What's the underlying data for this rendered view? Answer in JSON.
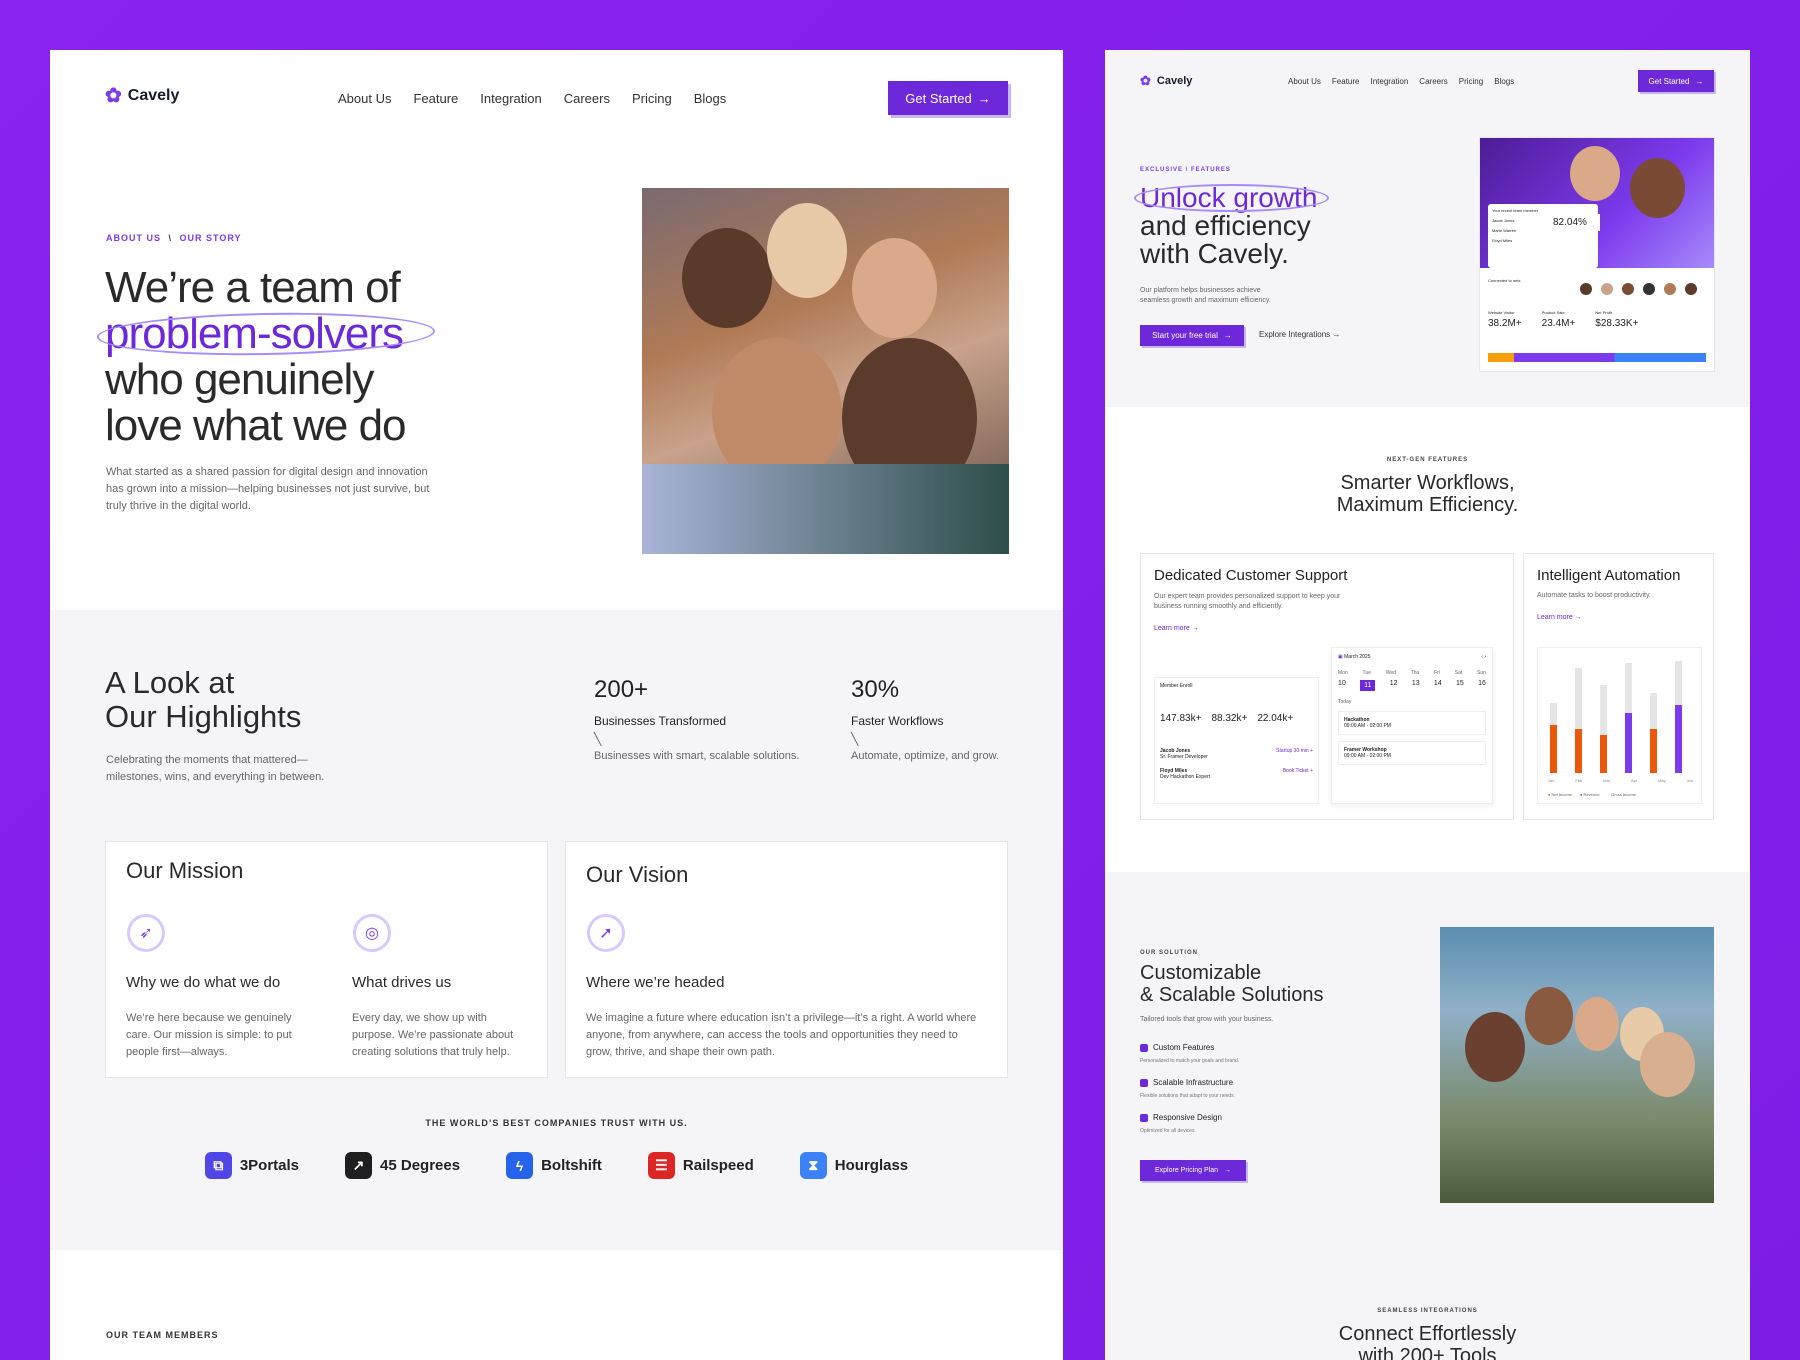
{
  "left": {
    "brand": "Cavely",
    "nav": [
      "About Us",
      "Feature",
      "Integration",
      "Careers",
      "Pricing",
      "Blogs"
    ],
    "cta": "Get Started",
    "cta_arrow": "→",
    "breadcrumb": {
      "a": "ABOUT US",
      "sep": "\\",
      "b": "OUR STORY"
    },
    "hero": {
      "line1": "We’re a team of",
      "highlight": "problem-solvers",
      "line3": "who genuinely",
      "line4": "love what we do",
      "desc": "What started as a shared passion for digital design and innovation has grown into a mission—helping businesses not just survive, but truly thrive in the digital world."
    },
    "highlights": {
      "title1": "A Look at",
      "title2": "Our Highlights",
      "desc": "Celebrating the moments that mattered—milestones, wins, and everything in between.",
      "stats": [
        {
          "value": "200+",
          "label": "Businesses Transformed",
          "note": "Businesses with smart, scalable solutions."
        },
        {
          "value": "30%",
          "label": "Faster Workflows",
          "note": "Automate, optimize, and grow."
        }
      ]
    },
    "mission": {
      "title": "Our Mission",
      "items": [
        {
          "title": "Why we do what we do",
          "desc": "We’re here because we genuinely care. Our mission is simple: to put people first—always."
        },
        {
          "title": "What drives us",
          "desc": "Every day, we show up with purpose. We’re passionate about creating solutions that truly help."
        }
      ]
    },
    "vision": {
      "title": "Our Vision",
      "item_title": "Where we’re headed",
      "desc": "We imagine a future where education isn’t a privilege—it’s a right. A world where anyone, from anywhere, can access the tools and opportunities they need to grow, thrive, and shape their own path."
    },
    "trust": "THE WORLD’S BEST COMPANIES TRUST WITH US.",
    "companies": [
      {
        "name": "3Portals",
        "color": "#4f46e5"
      },
      {
        "name": "45 Degrees",
        "color": "#1f1f1f"
      },
      {
        "name": "Boltshift",
        "color": "#2563eb"
      },
      {
        "name": "Railspeed",
        "color": "#dc2626"
      },
      {
        "name": "Hourglass",
        "color": "#3b82f6"
      }
    ],
    "team_eyebrow": "OUR TEAM MEMBERS"
  },
  "right": {
    "brand": "Cavely",
    "nav": [
      "About Us",
      "Feature",
      "Integration",
      "Careers",
      "Pricing",
      "Blogs"
    ],
    "cta": "Get Started",
    "cta_arrow": "→",
    "hero": {
      "eyebrow": "EXCLUSIVE \\ FEATURES",
      "highlight": "Unlock growth",
      "line2": "and efficiency",
      "line3": "with Cavely.",
      "desc": "Our platform helps businesses achieve seamless growth and maximum efficiency.",
      "primary": "Start your free trial",
      "secondary": "Explore Integrations",
      "arrow": "→"
    },
    "dash": {
      "team_title": "Your recent team member",
      "members": [
        "Jacob Jones",
        "Marie Warren",
        "Floyd Miles"
      ],
      "pct": "82.04%",
      "conn": "Connected to nets",
      "stats": [
        {
          "label": "Website Visitor",
          "value": "38.2M+"
        },
        {
          "label": "Product Sale",
          "value": "23.4M+"
        },
        {
          "label": "Net Profit",
          "value": "$28.33K+"
        }
      ]
    },
    "features": {
      "eyebrow": "NEXT-GEN FEATURES",
      "title1": "Smarter Workflows,",
      "title2": "Maximum Efficiency.",
      "support": {
        "title": "Dedicated Customer Support",
        "desc": "Our expert team provides personalized support to keep your business running smoothly and efficiently.",
        "link": "Learn more",
        "member_label": "Member Enroll",
        "nums": [
          "147.83k+",
          "88.32k+",
          "22.04k+"
        ],
        "people": [
          {
            "name": "Jacob Jones",
            "role": "Sr. Framer Developer",
            "action": "Startup 30 min +"
          },
          {
            "name": "Floyd Miles",
            "role": "Dev Hackathon Expert",
            "action": "Book Ticket +"
          }
        ],
        "cal_title": "March 2025",
        "days": [
          "Mon",
          "Tue",
          "Wed",
          "Thu",
          "Fri",
          "Sat",
          "Sun"
        ],
        "dates": [
          "10",
          "11",
          "12",
          "13",
          "14",
          "15",
          "16"
        ],
        "today": "Today",
        "events": [
          {
            "name": "Hackathon",
            "time": "09:00 AM - 02:00 PM"
          },
          {
            "name": "Framer Workshop",
            "time": "09:00 AM - 02:00 PM"
          }
        ]
      },
      "auto": {
        "title": "Intelligent Automation",
        "desc": "Automate tasks to boost productivity.",
        "link": "Learn more",
        "months": [
          "Jan",
          "Feb",
          "Mar",
          "Apr",
          "May",
          "Jun"
        ],
        "legend": [
          "Net Income",
          "Revenue",
          "Gross Income"
        ]
      }
    },
    "solution": {
      "eyebrow": "OUR SOLUTION",
      "title1": "Customizable",
      "title2": "& Scalable Solutions",
      "desc": "Tailored tools that grow with your business.",
      "items": [
        {
          "t": "Custom Features",
          "d": "Personalized to match your goals and brand."
        },
        {
          "t": "Scalable Infrastructure",
          "d": "Flexible solutions that adapt to your needs."
        },
        {
          "t": "Responsive Design",
          "d": "Optimized for all devices."
        }
      ],
      "cta": "Explore Pricing Plan"
    },
    "integr": {
      "eyebrow": "SEAMLESS INTEGRATIONS",
      "title1": "Connect Effortlessly",
      "title2": "with 200+ Tools"
    }
  },
  "colors": {
    "accent": "#6d28d9",
    "bg": "#8a22f0"
  }
}
